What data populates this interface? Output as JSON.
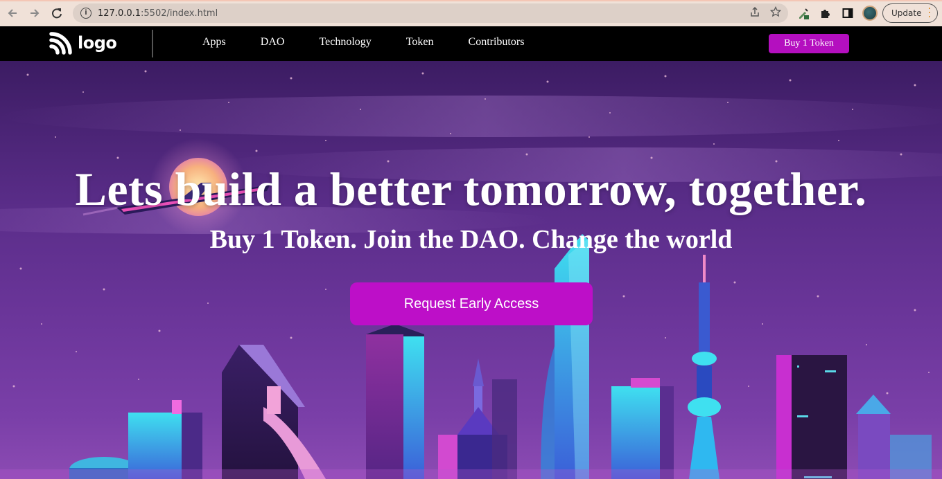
{
  "browser": {
    "url_host": "127.0.0.1",
    "url_rest": ":5502/index.html",
    "update_label": "Update"
  },
  "header": {
    "logo_text": "logo",
    "nav": [
      "Apps",
      "DAO",
      "Technology",
      "Token",
      "Contributors"
    ],
    "buy_label": "Buy 1 Token"
  },
  "hero": {
    "title": "Lets build a better tomorrow, together.",
    "subtitle": "Buy 1 Token. Join the DAO. Change the world",
    "cta_label": "Request Early Access"
  },
  "colors": {
    "accent": "#b40fbf",
    "header_bg": "#000000",
    "browser_bar": "#f0e1d8"
  },
  "icons": [
    "back-arrow-icon",
    "forward-arrow-icon",
    "reload-icon",
    "info-icon",
    "share-icon",
    "star-icon",
    "eyedropper-extension-icon",
    "puzzle-extensions-icon",
    "side-panel-icon",
    "profile-avatar",
    "more-menu-icon"
  ]
}
